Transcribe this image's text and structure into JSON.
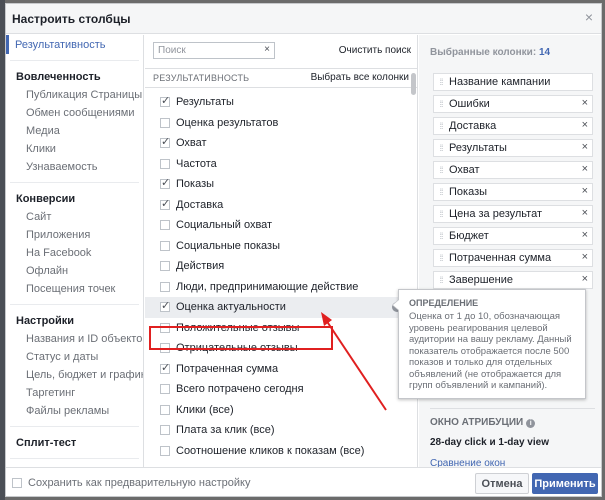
{
  "dialog": {
    "title": "Настроить столбцы",
    "close": "×"
  },
  "nav": {
    "sections": [
      {
        "head": "Результативность",
        "active": true,
        "items": []
      },
      {
        "head": "Вовлеченность",
        "active": false,
        "items": [
          "Публикация Страницы",
          "Обмен сообщениями",
          "Медиа",
          "Клики",
          "Узнаваемость"
        ]
      },
      {
        "head": "Конверсии",
        "active": false,
        "items": [
          "Сайт",
          "Приложения",
          "На Facebook",
          "Офлайн",
          "Посещения точек"
        ]
      },
      {
        "head": "Настройки",
        "active": false,
        "items": [
          "Названия и ID объектов",
          "Статус и даты",
          "Цель, бюджет и график",
          "Таргетинг",
          "Файлы рекламы"
        ]
      },
      {
        "head": "Сплит-тест",
        "active": false,
        "items": []
      }
    ]
  },
  "middle": {
    "search_placeholder": "Поиск",
    "search_clear": "×",
    "clear_search": "Очистить поиск",
    "section_label": "РЕЗУЛЬТАТИВНОСТЬ",
    "select_all": "Выбрать все колонки",
    "rows": [
      {
        "label": "Результаты",
        "checked": true
      },
      {
        "label": "Оценка результатов",
        "checked": false
      },
      {
        "label": "Охват",
        "checked": true
      },
      {
        "label": "Частота",
        "checked": false
      },
      {
        "label": "Показы",
        "checked": true
      },
      {
        "label": "Доставка",
        "checked": true
      },
      {
        "label": "Социальный охват",
        "checked": false
      },
      {
        "label": "Социальные показы",
        "checked": false
      },
      {
        "label": "Действия",
        "checked": false
      },
      {
        "label": "Люди, предпринимающие действие",
        "checked": false
      },
      {
        "label": "Оценка актуальности",
        "checked": true,
        "highlighted": true
      },
      {
        "label": "Положительные отзывы",
        "checked": false
      },
      {
        "label": "Отрицательные отзывы",
        "checked": false
      },
      {
        "label": "Потраченная сумма",
        "checked": true
      },
      {
        "label": "Всего потрачено сегодня",
        "checked": false
      },
      {
        "label": "Клики (все)",
        "checked": false
      },
      {
        "label": "Плата за клик (все)",
        "checked": false
      },
      {
        "label": "Соотношение кликов к показам (все)",
        "checked": false
      }
    ]
  },
  "right": {
    "title": "Выбранные колонки:",
    "count": "14",
    "chips": [
      {
        "label": "Название кампании",
        "removable": false
      },
      {
        "label": "Ошибки",
        "removable": true
      },
      {
        "label": "Доставка",
        "removable": true
      },
      {
        "label": "Результаты",
        "removable": true
      },
      {
        "label": "Охват",
        "removable": true
      },
      {
        "label": "Показы",
        "removable": true
      },
      {
        "label": "Цена за результат",
        "removable": true
      },
      {
        "label": "Бюджет",
        "removable": true
      },
      {
        "label": "Потраченная сумма",
        "removable": true
      },
      {
        "label": "Завершение",
        "removable": true
      }
    ],
    "attribution_title": "ОКНО АТРИБУЦИИ",
    "attribution_value": "28-day click и 1-day view",
    "compare_link": "Сравнение окон"
  },
  "tooltip": {
    "title": "ОПРЕДЕЛЕНИЕ",
    "body": "Оценка от 1 до 10, обозначающая уровень реагирования целевой аудитории на вашу рекламу. Данный показатель отображается после 500 показов и только для отдельных объявлений (не отображается для групп объявлений и кампаний)."
  },
  "footer": {
    "save_preset": "Сохранить как предварительную настройку",
    "cancel": "Отмена",
    "apply": "Применить"
  },
  "colors": {
    "accent": "#4267b2",
    "annotation": "#e02020"
  }
}
